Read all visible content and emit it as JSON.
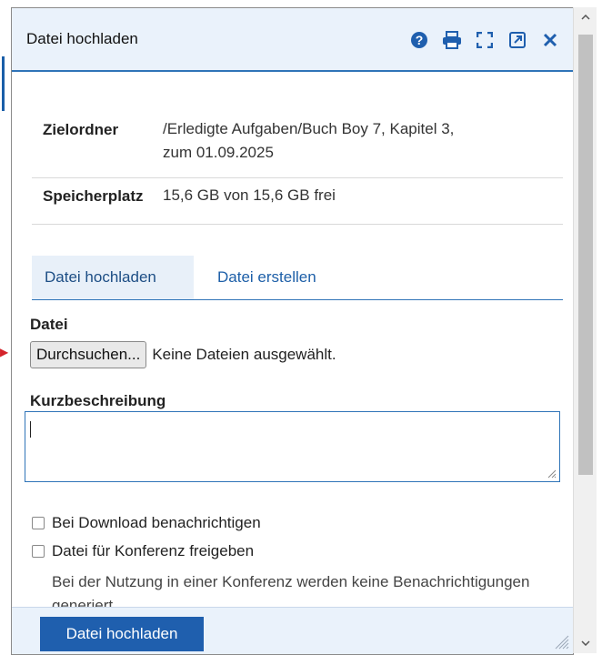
{
  "dialog": {
    "title": "Datei hochladen",
    "header_icons": [
      "help-icon",
      "print-icon",
      "fullscreen-icon",
      "open-external-icon",
      "close-icon"
    ]
  },
  "info": {
    "target_folder_label": "Zielordner",
    "target_folder_line1": "/Erledigte Aufgaben/Buch Boy 7, Kapitel 3,",
    "target_folder_line2": "zum 01.09.2025",
    "storage_label": "Speicherplatz",
    "storage_value": "15,6 GB von 15,6 GB frei"
  },
  "tabs": {
    "active": "Datei hochladen",
    "inactive": "Datei erstellen"
  },
  "form": {
    "file_label": "Datei",
    "browse_label": "Durchsuchen...",
    "file_status": "Keine Dateien ausgewählt.",
    "description_label": "Kurzbeschreibung",
    "description_value": "",
    "notify_label": "Bei Download benachrichtigen",
    "conference_label": "Datei für Konferenz freigeben",
    "hint_text": "Bei der Nutzung in einer Konferenz werden keine Benachrichtigungen generiert"
  },
  "footer": {
    "submit_label": "Datei hochladen"
  },
  "colors": {
    "accent": "#2f74b8",
    "primary_button": "#1f5fae",
    "header_bg": "#eaf2fb"
  }
}
